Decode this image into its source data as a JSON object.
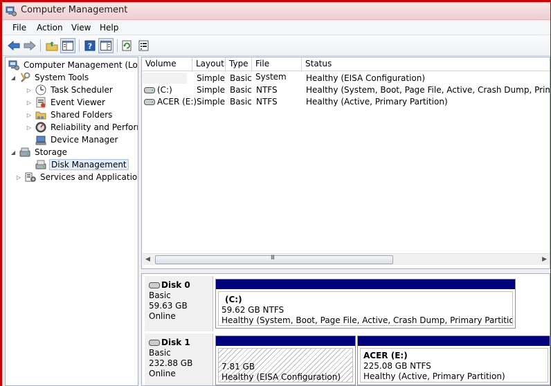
{
  "window": {
    "title": "Computer Management"
  },
  "menu": {
    "file": "File",
    "action": "Action",
    "view": "View",
    "help": "Help"
  },
  "tree": {
    "root": "Computer Management (Local",
    "system_tools": "System Tools",
    "task_scheduler": "Task Scheduler",
    "event_viewer": "Event Viewer",
    "shared_folders": "Shared Folders",
    "reliability": "Reliability and Performa",
    "device_manager": "Device Manager",
    "storage": "Storage",
    "disk_management": "Disk Management",
    "services": "Services and Applications"
  },
  "volume_list": {
    "columns": {
      "volume": "Volume",
      "layout": "Layout",
      "type": "Type",
      "fs": "File System",
      "status": "Status"
    },
    "rows": [
      {
        "volume": "",
        "layout": "Simple",
        "type": "Basic",
        "fs": "",
        "status": "Healthy (EISA Configuration)"
      },
      {
        "volume": "(C:)",
        "layout": "Simple",
        "type": "Basic",
        "fs": "NTFS",
        "status": "Healthy (System, Boot, Page File, Active, Crash Dump, Primary Parti"
      },
      {
        "volume": "ACER (E:)",
        "layout": "Simple",
        "type": "Basic",
        "fs": "NTFS",
        "status": "Healthy (Active, Primary Partition)"
      }
    ],
    "scroll_grip": "III"
  },
  "disks": [
    {
      "name": "Disk 0",
      "type": "Basic",
      "size": "59.63 GB",
      "state": "Online",
      "partitions": [
        {
          "name": "(C:)",
          "size": "59.62 GB NTFS",
          "status": "Healthy (System, Boot, Page File, Active, Crash Dump, Primary Partition)"
        }
      ]
    },
    {
      "name": "Disk 1",
      "type": "Basic",
      "size": "232.88 GB",
      "state": "Online",
      "partitions": [
        {
          "name": "",
          "size": "7.81 GB",
          "status": "Healthy (EISA Configuration)"
        },
        {
          "name": "ACER  (E:)",
          "size": "225.08 GB NTFS",
          "status": "Healthy (Active, Primary Partition)"
        }
      ]
    }
  ],
  "colors": {
    "partition_bar": "#00007f",
    "selection": "#e3ecf8",
    "frame": "#cc0000"
  }
}
